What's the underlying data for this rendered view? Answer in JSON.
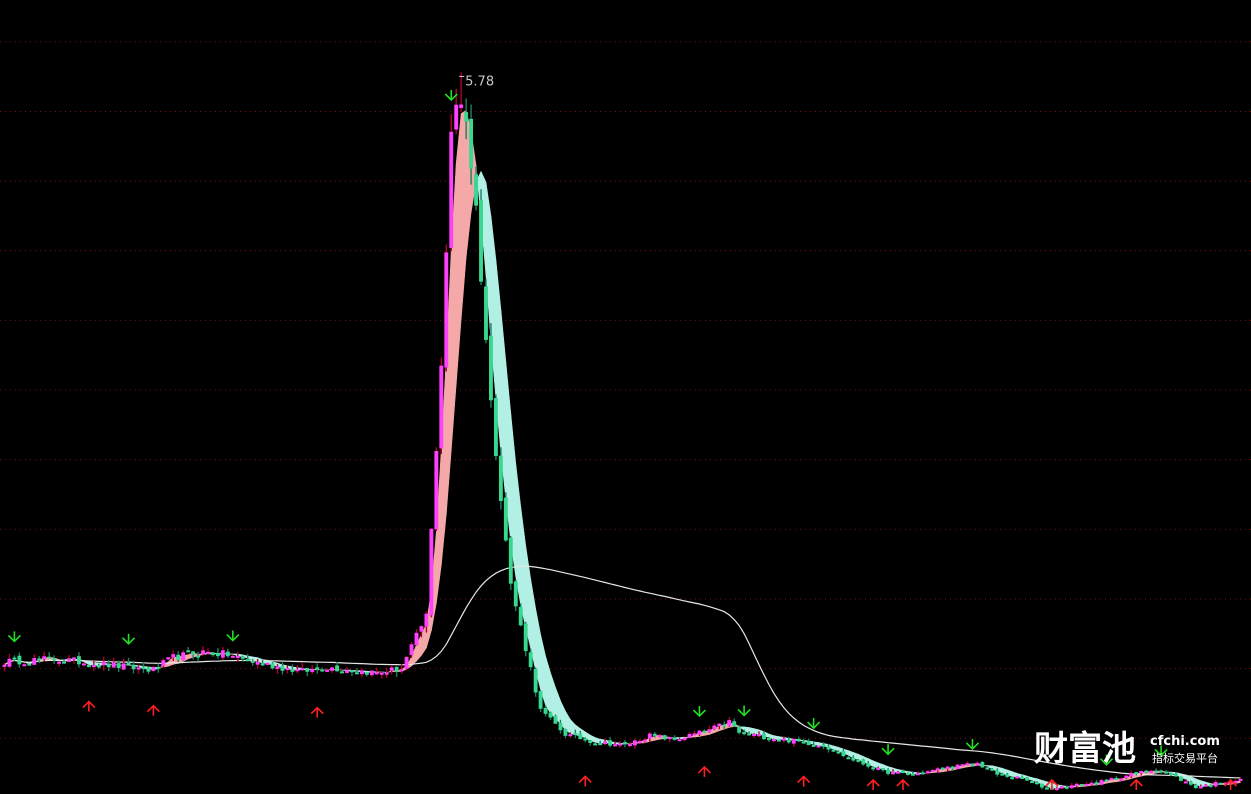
{
  "chart_data": {
    "type": "candlestick",
    "peak_label": "5.78",
    "y_range": [
      0.6,
      6.3
    ],
    "grid": true,
    "grid_style": "dotted",
    "colors": {
      "background": "#000000",
      "grid": "#7a1010",
      "up_body": "#ff40ff",
      "up_wick": "#b00030",
      "down_body": "#38d890",
      "down_wick": "#1a8060",
      "long_ma": "#e6e6e6",
      "ribbon_up": "#f4a8a8",
      "ribbon_down": "#b2f0e6",
      "buy_arrow": "#ff2020",
      "sell_arrow": "#20e020"
    },
    "price_keypoints": [
      [
        0,
        1.55
      ],
      [
        10,
        1.57
      ],
      [
        20,
        1.53
      ],
      [
        30,
        1.49
      ],
      [
        34,
        1.58
      ],
      [
        40,
        1.62
      ],
      [
        45,
        1.6
      ],
      [
        50,
        1.55
      ],
      [
        60,
        1.48
      ],
      [
        65,
        1.51
      ],
      [
        75,
        1.47
      ],
      [
        80,
        1.5
      ],
      [
        85,
        1.88
      ],
      [
        88,
        3.7
      ],
      [
        90,
        5.3
      ],
      [
        92,
        5.78
      ],
      [
        95,
        4.8
      ],
      [
        98,
        3.4
      ],
      [
        102,
        2.1
      ],
      [
        108,
        1.2
      ],
      [
        113,
        1.03
      ],
      [
        118,
        0.98
      ],
      [
        125,
        0.95
      ],
      [
        130,
        1.02
      ],
      [
        135,
        0.99
      ],
      [
        142,
        1.06
      ],
      [
        146,
        1.12
      ],
      [
        148,
        1.04
      ],
      [
        155,
        1.0
      ],
      [
        165,
        0.95
      ],
      [
        170,
        0.86
      ],
      [
        177,
        0.76
      ],
      [
        183,
        0.74
      ],
      [
        190,
        0.79
      ],
      [
        196,
        0.82
      ],
      [
        200,
        0.74
      ],
      [
        205,
        0.71
      ],
      [
        210,
        0.64
      ],
      [
        220,
        0.68
      ],
      [
        227,
        0.74
      ],
      [
        232,
        0.78
      ],
      [
        236,
        0.72
      ],
      [
        240,
        0.65
      ],
      [
        246,
        0.69
      ],
      [
        249,
        0.7
      ]
    ],
    "sell_signals": [
      2,
      25,
      46,
      90,
      140,
      149,
      163,
      178,
      195,
      222,
      233
    ],
    "buy_signals": [
      17,
      30,
      63,
      117,
      141,
      161,
      175,
      181,
      211,
      228,
      247
    ]
  },
  "watermark": {
    "brand": "财富池",
    "url": "cfchi.com",
    "tagline": "指标交易平台"
  }
}
